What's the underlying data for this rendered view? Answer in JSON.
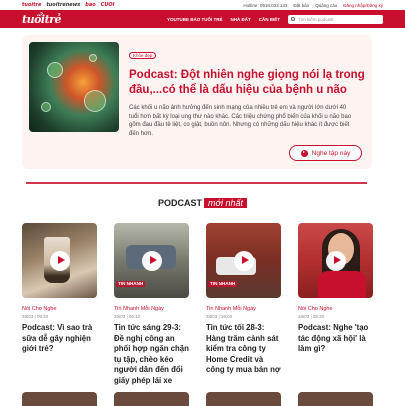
{
  "topstrip": {
    "brands": [
      "tuoitre",
      "tuoitrenews",
      "bao",
      "CUOI"
    ],
    "hotline": "Hotline: 0918.033.133",
    "subscribe": "Đặt báo",
    "ads": "Quảng cáo",
    "login": "Đăng nhập/Đăng ký"
  },
  "header": {
    "logo": "tuổitrẻ",
    "nav": [
      "YOUTUBE BÁO TUỔI TRẺ",
      "NHÀ ĐẤT",
      "CẦN BIẾT"
    ],
    "search_placeholder": "Tìm kiếm podcast"
  },
  "hero": {
    "tag": "Khỏe đẹp",
    "title": "Podcast: Đột nhiên nghe giọng nói lạ trong đầu,...có thể là dấu hiệu của bệnh u não",
    "description": "Các khối u não ảnh hưởng đến sinh mạng của nhiều trẻ em và người lớn dưới 40 tuổi hơn bất kỳ loại ung thư nào khác. Các triệu chứng phổ biến của khối u não bao gồm đau đầu tê liệt, co giật, buồn nôn. Nhưng có những dấu hiệu khác ít được biết đến hơn.",
    "listen_label": "Nghe tập này"
  },
  "section": {
    "title_main": "PODCAST",
    "title_highlight": "mới nhất"
  },
  "podcasts": [
    {
      "category": "Nói Cho Nghe",
      "date": "29/03 | 09:30",
      "title": "Podcast: Vì sao trà sữa dễ gây nghiện giới trẻ?",
      "overlay": ""
    },
    {
      "category": "Tin Nhanh Mỗi Ngày",
      "date": "29/03 | 06:12",
      "title": "Tin tức sáng 29-3: Đề nghị công an phối hợp ngăn chặn tụ tập, chèo kéo người dân đến đổi giấy phép lái xe",
      "overlay": "TIN NHANH"
    },
    {
      "category": "Tin Nhanh Mỗi Ngày",
      "date": "28/03 | 19:00",
      "title": "Tin tức tối 28-3: Hàng trăm cảnh sát kiểm tra công ty Home Credit và công ty mua bán nợ",
      "overlay": "TIN NHANH"
    },
    {
      "category": "Nói Cho Nghe",
      "date": "28/03 | 09:30",
      "title": "Podcast: Nghe 'tạo tác động xã hội' là làm gì?",
      "overlay": ""
    }
  ]
}
